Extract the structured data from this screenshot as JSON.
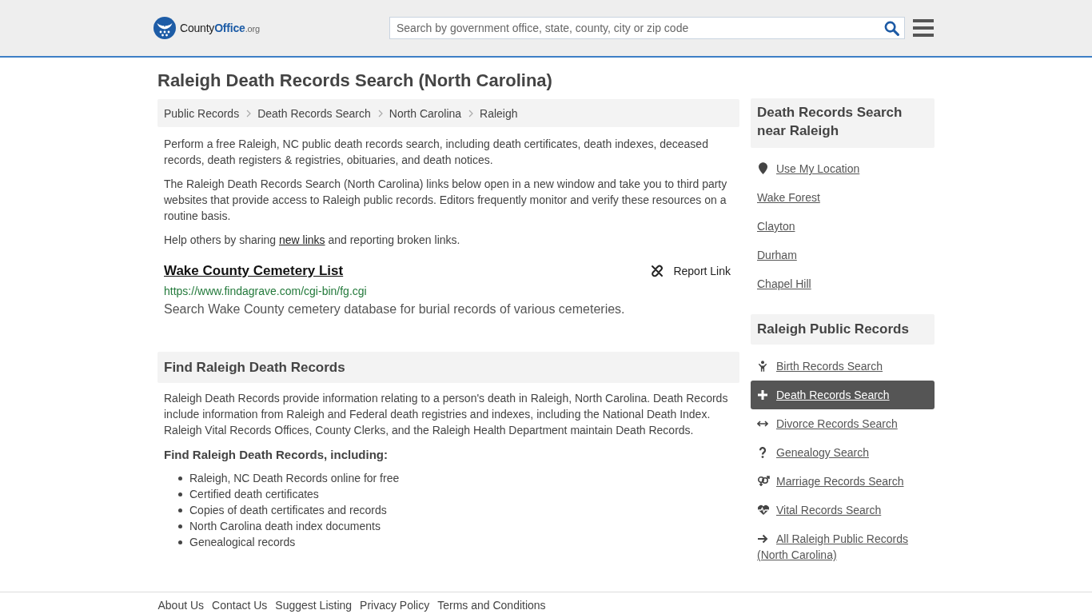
{
  "header": {
    "logo": {
      "name": "County",
      "highlight": "Office",
      "suffix": ".org"
    },
    "search": {
      "placeholder": "Search by government office, state, county, city or zip code"
    }
  },
  "page_title": "Raleigh Death Records Search (North Carolina)",
  "breadcrumbs": [
    "Public Records",
    "Death Records Search",
    "North Carolina",
    "Raleigh"
  ],
  "intro": [
    "Perform a free Raleigh, NC public death records search, including death certificates, death indexes, deceased records, death registers & registries, obituaries, and death notices.",
    "The Raleigh Death Records Search (North Carolina) links below open in a new window and take you to third party websites that provide access to Raleigh public records. Editors frequently monitor and verify these resources on a routine basis."
  ],
  "share_note": {
    "before": "Help others by sharing",
    "link": "new links",
    "after": "and reporting broken links."
  },
  "resources": [
    {
      "title": "Wake County Cemetery List",
      "url": "https://www.findagrave.com/cgi-bin/fg.cgi",
      "description": "Search Wake County cemetery database for burial records of various cemeteries.",
      "report_label": "Report Link"
    }
  ],
  "find_section": {
    "heading": "Find Raleigh Death Records",
    "paragraph": "Raleigh Death Records provide information relating to a person's death in Raleigh, North Carolina. Death Records include information from Raleigh and Federal death registries and indexes, including the National Death Index. Raleigh Vital Records Offices, County Clerks, and the Raleigh Health Department maintain Death Records.",
    "list_heading": "Find Raleigh Death Records, including:",
    "items": [
      "Raleigh, NC Death Records online for free",
      "Certified death certificates",
      "Copies of death certificates and records",
      "North Carolina death index documents",
      "Genealogical records"
    ]
  },
  "sidebar": {
    "nearby": {
      "heading": "Death Records Search near Raleigh",
      "location_link": "Use My Location",
      "places": [
        "Wake Forest",
        "Clayton",
        "Durham",
        "Chapel Hill"
      ]
    },
    "public_records": {
      "heading": "Raleigh Public Records",
      "items": [
        {
          "label": "Birth Records Search",
          "kind": "birth",
          "selected": false
        },
        {
          "label": "Death Records Search",
          "kind": "death",
          "selected": true
        },
        {
          "label": "Divorce Records Search",
          "kind": "divorce",
          "selected": false
        },
        {
          "label": "Genealogy Search",
          "kind": "genealogy",
          "selected": false
        },
        {
          "label": "Marriage Records Search",
          "kind": "marriage",
          "selected": false
        },
        {
          "label": "Vital Records Search",
          "kind": "vital",
          "selected": false
        },
        {
          "label": "All Raleigh Public Records (North Carolina)",
          "kind": "all",
          "selected": false
        }
      ]
    }
  },
  "footer": {
    "links": [
      "About Us",
      "Contact Us",
      "Suggest Listing",
      "Privacy Policy",
      "Terms and Conditions"
    ]
  }
}
